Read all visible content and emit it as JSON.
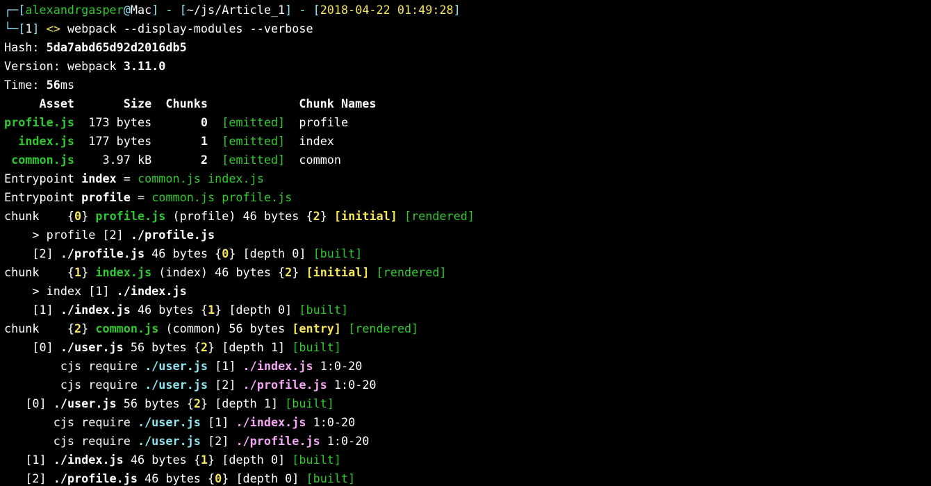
{
  "terminal": {
    "colors": {
      "background": "#000000",
      "text": "#ffffff",
      "green": "#2fc92f",
      "yellow": "#f6e65a",
      "cyan": "#8de6f0",
      "magenta": "#f4a6f4"
    },
    "lines": [
      {
        "name": "prompt-line",
        "segs": [
          {
            "t": "┌─[",
            "c": "c"
          },
          {
            "t": "alexandrgasper",
            "c": "g"
          },
          {
            "t": "@",
            "c": "c"
          },
          {
            "t": "Mac",
            "c": "w"
          },
          {
            "t": "] - [",
            "c": "c"
          },
          {
            "t": "~/js/Article_1",
            "c": "w"
          },
          {
            "t": "] - [",
            "c": "c"
          },
          {
            "t": "2018-04-22 01:49:28",
            "c": "y"
          },
          {
            "t": "]",
            "c": "c"
          }
        ]
      },
      {
        "name": "command-line",
        "segs": [
          {
            "t": "└─[",
            "c": "c"
          },
          {
            "t": "1",
            "c": "w"
          },
          {
            "t": "] ",
            "c": "c"
          },
          {
            "t": "<> ",
            "c": "y"
          },
          {
            "t": "webpack --display-modules --verbose",
            "c": "w"
          }
        ]
      },
      {
        "name": "hash-line",
        "segs": [
          {
            "t": "Hash: ",
            "c": "w"
          },
          {
            "t": "5da7abd65d92d2016db5",
            "c": "wb"
          }
        ]
      },
      {
        "name": "version-line",
        "segs": [
          {
            "t": "Version: webpack ",
            "c": "w"
          },
          {
            "t": "3.11.0",
            "c": "wb"
          }
        ]
      },
      {
        "name": "time-line",
        "segs": [
          {
            "t": "Time: ",
            "c": "w"
          },
          {
            "t": "56",
            "c": "wb"
          },
          {
            "t": "ms",
            "c": "w"
          }
        ]
      },
      {
        "name": "asset-table-header",
        "segs": [
          {
            "t": "     Asset       Size  Chunks             Chunk Names",
            "c": "wb"
          }
        ]
      },
      {
        "name": "asset-row-profile",
        "segs": [
          {
            "t": "profile.js",
            "c": "gb"
          },
          {
            "t": "  173 bytes       ",
            "c": "w"
          },
          {
            "t": "0",
            "c": "wb"
          },
          {
            "t": "  ",
            "c": "w"
          },
          {
            "t": "[emitted]",
            "c": "g"
          },
          {
            "t": "  profile",
            "c": "w"
          }
        ]
      },
      {
        "name": "asset-row-index",
        "segs": [
          {
            "t": "  index.js",
            "c": "gb"
          },
          {
            "t": "  177 bytes       ",
            "c": "w"
          },
          {
            "t": "1",
            "c": "wb"
          },
          {
            "t": "  ",
            "c": "w"
          },
          {
            "t": "[emitted]",
            "c": "g"
          },
          {
            "t": "  index",
            "c": "w"
          }
        ]
      },
      {
        "name": "asset-row-common",
        "segs": [
          {
            "t": " common.js",
            "c": "gb"
          },
          {
            "t": "    3.97 kB       ",
            "c": "w"
          },
          {
            "t": "2",
            "c": "wb"
          },
          {
            "t": "  ",
            "c": "w"
          },
          {
            "t": "[emitted]",
            "c": "g"
          },
          {
            "t": "  common",
            "c": "w"
          }
        ]
      },
      {
        "name": "entrypoint-index",
        "segs": [
          {
            "t": "Entrypoint ",
            "c": "w"
          },
          {
            "t": "index",
            "c": "wb"
          },
          {
            "t": " = ",
            "c": "w"
          },
          {
            "t": "common.js index.js",
            "c": "g"
          }
        ]
      },
      {
        "name": "entrypoint-profile",
        "segs": [
          {
            "t": "Entrypoint ",
            "c": "w"
          },
          {
            "t": "profile",
            "c": "wb"
          },
          {
            "t": " = ",
            "c": "w"
          },
          {
            "t": "common.js profile.js",
            "c": "g"
          }
        ]
      },
      {
        "name": "chunk-0-line",
        "segs": [
          {
            "t": "chunk    {",
            "c": "w"
          },
          {
            "t": "0",
            "c": "yb"
          },
          {
            "t": "} ",
            "c": "w"
          },
          {
            "t": "profile.js",
            "c": "gb"
          },
          {
            "t": " (profile) 46 bytes {",
            "c": "w"
          },
          {
            "t": "2",
            "c": "yb"
          },
          {
            "t": "} ",
            "c": "w"
          },
          {
            "t": "[initial]",
            "c": "yb"
          },
          {
            "t": " ",
            "c": "w"
          },
          {
            "t": "[rendered]",
            "c": "g"
          }
        ]
      },
      {
        "name": "chunk-0-reason",
        "segs": [
          {
            "t": "    > profile [2] ",
            "c": "w"
          },
          {
            "t": "./profile.js",
            "c": "wb"
          }
        ]
      },
      {
        "name": "chunk-0-module",
        "segs": [
          {
            "t": "    [2] ",
            "c": "w"
          },
          {
            "t": "./profile.js",
            "c": "wb"
          },
          {
            "t": " 46 bytes {",
            "c": "w"
          },
          {
            "t": "0",
            "c": "yb"
          },
          {
            "t": "} [depth 0] ",
            "c": "w"
          },
          {
            "t": "[built]",
            "c": "g"
          }
        ]
      },
      {
        "name": "chunk-1-line",
        "segs": [
          {
            "t": "chunk    {",
            "c": "w"
          },
          {
            "t": "1",
            "c": "yb"
          },
          {
            "t": "} ",
            "c": "w"
          },
          {
            "t": "index.js",
            "c": "gb"
          },
          {
            "t": " (index) 46 bytes {",
            "c": "w"
          },
          {
            "t": "2",
            "c": "yb"
          },
          {
            "t": "} ",
            "c": "w"
          },
          {
            "t": "[initial]",
            "c": "yb"
          },
          {
            "t": " ",
            "c": "w"
          },
          {
            "t": "[rendered]",
            "c": "g"
          }
        ]
      },
      {
        "name": "chunk-1-reason",
        "segs": [
          {
            "t": "    > index [1] ",
            "c": "w"
          },
          {
            "t": "./index.js",
            "c": "wb"
          }
        ]
      },
      {
        "name": "chunk-1-module",
        "segs": [
          {
            "t": "    [1] ",
            "c": "w"
          },
          {
            "t": "./index.js",
            "c": "wb"
          },
          {
            "t": " 46 bytes {",
            "c": "w"
          },
          {
            "t": "1",
            "c": "yb"
          },
          {
            "t": "} [depth 0] ",
            "c": "w"
          },
          {
            "t": "[built]",
            "c": "g"
          }
        ]
      },
      {
        "name": "chunk-2-line",
        "segs": [
          {
            "t": "chunk    {",
            "c": "w"
          },
          {
            "t": "2",
            "c": "yb"
          },
          {
            "t": "} ",
            "c": "w"
          },
          {
            "t": "common.js",
            "c": "gb"
          },
          {
            "t": " (common) 56 bytes ",
            "c": "w"
          },
          {
            "t": "[entry]",
            "c": "yb"
          },
          {
            "t": " ",
            "c": "w"
          },
          {
            "t": "[rendered]",
            "c": "g"
          }
        ]
      },
      {
        "name": "chunk-2-module",
        "segs": [
          {
            "t": "    [0] ",
            "c": "w"
          },
          {
            "t": "./user.js",
            "c": "wb"
          },
          {
            "t": " 56 bytes {",
            "c": "w"
          },
          {
            "t": "2",
            "c": "yb"
          },
          {
            "t": "} [depth 1] ",
            "c": "w"
          },
          {
            "t": "[built]",
            "c": "g"
          }
        ]
      },
      {
        "name": "chunk-2-require-index",
        "segs": [
          {
            "t": "        cjs require ",
            "c": "w"
          },
          {
            "t": "./user.js",
            "c": "cb"
          },
          {
            "t": " [1] ",
            "c": "w"
          },
          {
            "t": "./index.js",
            "c": "mb"
          },
          {
            "t": " 1:0-20",
            "c": "w"
          }
        ]
      },
      {
        "name": "chunk-2-require-profile",
        "segs": [
          {
            "t": "        cjs require ",
            "c": "w"
          },
          {
            "t": "./user.js",
            "c": "cb"
          },
          {
            "t": " [2] ",
            "c": "w"
          },
          {
            "t": "./profile.js",
            "c": "mb"
          },
          {
            "t": " 1:0-20",
            "c": "w"
          }
        ]
      },
      {
        "name": "module-user",
        "segs": [
          {
            "t": "   [0] ",
            "c": "w"
          },
          {
            "t": "./user.js",
            "c": "wb"
          },
          {
            "t": " 56 bytes {",
            "c": "w"
          },
          {
            "t": "2",
            "c": "yb"
          },
          {
            "t": "} [depth 1] ",
            "c": "w"
          },
          {
            "t": "[built]",
            "c": "g"
          }
        ]
      },
      {
        "name": "module-user-require-index",
        "segs": [
          {
            "t": "       cjs require ",
            "c": "w"
          },
          {
            "t": "./user.js",
            "c": "cb"
          },
          {
            "t": " [1] ",
            "c": "w"
          },
          {
            "t": "./index.js",
            "c": "mb"
          },
          {
            "t": " 1:0-20",
            "c": "w"
          }
        ]
      },
      {
        "name": "module-user-require-profile",
        "segs": [
          {
            "t": "       cjs require ",
            "c": "w"
          },
          {
            "t": "./user.js",
            "c": "cb"
          },
          {
            "t": " [2] ",
            "c": "w"
          },
          {
            "t": "./profile.js",
            "c": "mb"
          },
          {
            "t": " 1:0-20",
            "c": "w"
          }
        ]
      },
      {
        "name": "module-index",
        "segs": [
          {
            "t": "   [1] ",
            "c": "w"
          },
          {
            "t": "./index.js",
            "c": "wb"
          },
          {
            "t": " 46 bytes {",
            "c": "w"
          },
          {
            "t": "1",
            "c": "yb"
          },
          {
            "t": "} [depth 0] ",
            "c": "w"
          },
          {
            "t": "[built]",
            "c": "g"
          }
        ]
      },
      {
        "name": "module-profile",
        "segs": [
          {
            "t": "   [2] ",
            "c": "w"
          },
          {
            "t": "./profile.js",
            "c": "wb"
          },
          {
            "t": " 46 bytes {",
            "c": "w"
          },
          {
            "t": "0",
            "c": "yb"
          },
          {
            "t": "} [depth 0] ",
            "c": "w"
          },
          {
            "t": "[built]",
            "c": "g"
          }
        ]
      }
    ]
  }
}
